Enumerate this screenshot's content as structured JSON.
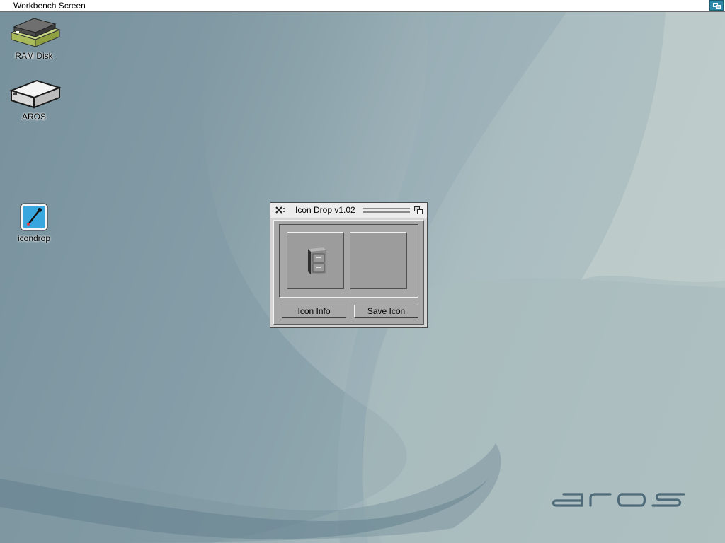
{
  "screen": {
    "title": "Workbench Screen",
    "depth_gadget_icon": "screen-depth-icon"
  },
  "desktop": {
    "icons": [
      {
        "label": "RAM Disk",
        "icon": "ram-disk-icon"
      },
      {
        "label": "AROS",
        "icon": "hard-drive-icon"
      },
      {
        "label": "icondrop",
        "icon": "icondrop-app-icon"
      }
    ],
    "logo": {
      "text": "aros",
      "icon": "aros-logo"
    }
  },
  "window": {
    "title": "Icon Drop v1.02",
    "close_icon": "close-icon",
    "depth_icon": "window-depth-icon",
    "slots": [
      {
        "icon": "file-cabinet-icon"
      },
      {
        "icon": ""
      }
    ],
    "buttons": {
      "icon_info": "Icon Info",
      "save_icon": "Save Icon"
    }
  },
  "colors": {
    "screen_bar": "#ffffff",
    "depth_gadget": "#2c8aa8",
    "window_bg": "#a8a8a8",
    "backdrop": "#8ba2ab"
  }
}
